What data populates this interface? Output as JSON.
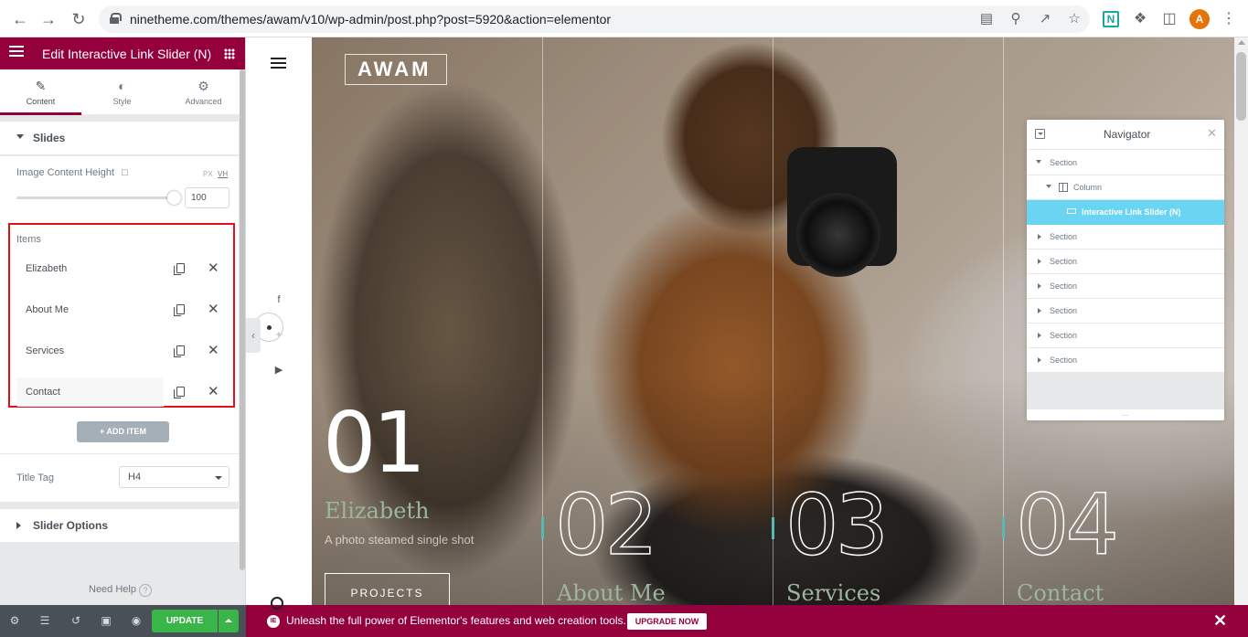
{
  "browser": {
    "url": "ninetheme.com/themes/awam/v10/wp-admin/post.php?post=5920&action=elementor",
    "avatar_letter": "A",
    "extension_letter": "N",
    "icons": [
      "back-icon",
      "forward-icon",
      "reload-icon",
      "lock-icon",
      "translate-icon",
      "zoom-icon",
      "share-icon",
      "bookmark-star-icon",
      "extensions-icon",
      "sidepanel-icon",
      "menu-icon"
    ]
  },
  "panel": {
    "title": "Edit Interactive Link Slider (N)",
    "tabs": [
      {
        "label": "Content",
        "icon": "pencil-icon",
        "active": true
      },
      {
        "label": "Style",
        "icon": "contrast-icon",
        "active": false
      },
      {
        "label": "Advanced",
        "icon": "gear-icon",
        "active": false
      }
    ],
    "slides_section": "Slides",
    "image_content_height": {
      "label": "Image Content Height",
      "units": [
        "PX",
        "VH"
      ],
      "active_unit": "VH",
      "value": "100"
    },
    "items_label": "Items",
    "items": [
      "Elizabeth",
      "About Me",
      "Services",
      "Contact"
    ],
    "add_item": "ADD ITEM",
    "title_tag": {
      "label": "Title Tag",
      "value": "H4"
    },
    "slider_options": "Slider Options",
    "need_help": "Need Help",
    "help_symbol": "?"
  },
  "footer": {
    "update": "UPDATE"
  },
  "promo": {
    "logo": "IE",
    "text": "Unleash the full power of Elementor's features and web creation tools.",
    "button": "UPGRADE NOW",
    "close": "✕"
  },
  "preview": {
    "logo": "AWAM",
    "slides": [
      {
        "number": "01",
        "title": "Elizabeth",
        "subtitle": "A photo steamed single shot",
        "button": "PROJECTS"
      },
      {
        "number": "02",
        "title": "About Me"
      },
      {
        "number": "03",
        "title": "Services"
      },
      {
        "number": "04",
        "title": "Contact"
      }
    ],
    "accent_color": "#9cb59d"
  },
  "navigator": {
    "title": "Navigator",
    "rows": [
      {
        "label": "Section",
        "level": 0,
        "expanded": true
      },
      {
        "label": "Column",
        "level": 1,
        "expanded": true
      },
      {
        "label": "Interactive Link Slider (N)",
        "level": 2,
        "selected": true
      },
      {
        "label": "Section",
        "level": 0,
        "expanded": false
      },
      {
        "label": "Section",
        "level": 0,
        "expanded": false
      },
      {
        "label": "Section",
        "level": 0,
        "expanded": false
      },
      {
        "label": "Section",
        "level": 0,
        "expanded": false
      },
      {
        "label": "Section",
        "level": 0,
        "expanded": false
      },
      {
        "label": "Section",
        "level": 0,
        "expanded": false
      }
    ],
    "resize": "..."
  },
  "colors": {
    "brand": "#93003c",
    "update_green": "#39b54a",
    "navigator_selected": "#6ad5f2",
    "highlight_box": "#e3101b"
  }
}
